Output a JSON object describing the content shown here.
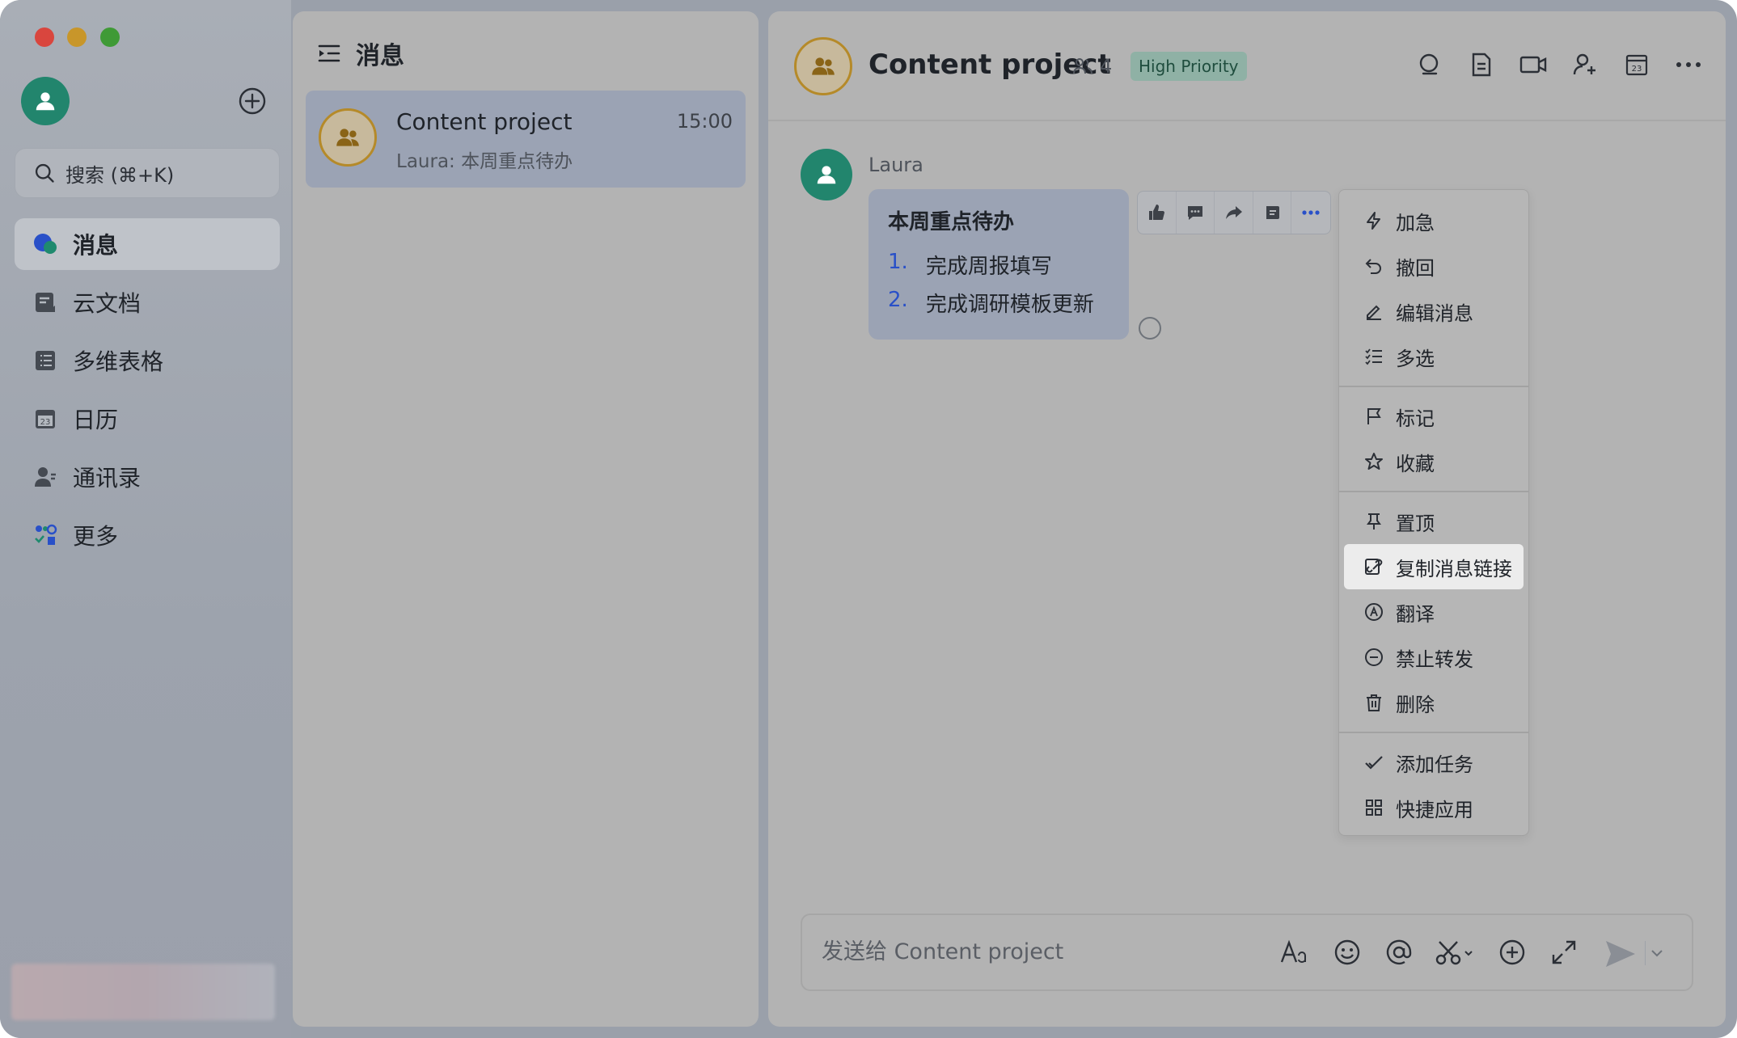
{
  "window": {
    "traffic_lights": [
      "close",
      "minimize",
      "zoom"
    ]
  },
  "sidebar": {
    "search_placeholder": "搜索 (⌘+K)",
    "items": [
      {
        "label": "消息",
        "icon": "chat-bubbles-icon",
        "active": true
      },
      {
        "label": "云文档",
        "icon": "doc-icon"
      },
      {
        "label": "多维表格",
        "icon": "table-icon"
      },
      {
        "label": "日历",
        "icon": "calendar-icon"
      },
      {
        "label": "通讯录",
        "icon": "contacts-icon"
      },
      {
        "label": "更多",
        "icon": "apps-grid-icon"
      }
    ]
  },
  "list": {
    "title": "消息",
    "chats": [
      {
        "name": "Content project",
        "time": "15:00",
        "preview": "Laura: 本周重点待办"
      }
    ]
  },
  "chat": {
    "title": "Content project",
    "members": "4",
    "badge": "High Priority",
    "accent": "#2950c8",
    "message": {
      "sender": "Laura",
      "title": "本周重点待办",
      "items": [
        {
          "num": "1.",
          "text": "完成周报填写"
        },
        {
          "num": "2.",
          "text": "完成调研模板更新"
        }
      ]
    },
    "composer_placeholder": "发送给 Content project"
  },
  "context_menu": {
    "groups": [
      [
        {
          "label": "加急",
          "icon": "lightning-icon"
        },
        {
          "label": "撤回",
          "icon": "undo-icon"
        },
        {
          "label": "编辑消息",
          "icon": "edit-icon"
        },
        {
          "label": "多选",
          "icon": "multi-select-icon"
        }
      ],
      [
        {
          "label": "标记",
          "icon": "flag-icon"
        },
        {
          "label": "收藏",
          "icon": "star-icon"
        }
      ],
      [
        {
          "label": "置顶",
          "icon": "pin-icon"
        },
        {
          "label": "复制消息链接",
          "icon": "link-icon",
          "highlight": true
        },
        {
          "label": "翻译",
          "icon": "translate-icon"
        },
        {
          "label": "禁止转发",
          "icon": "forbid-icon"
        },
        {
          "label": "删除",
          "icon": "trash-icon"
        }
      ],
      [
        {
          "label": "添加任务",
          "icon": "task-check-icon"
        },
        {
          "label": "快捷应用",
          "icon": "quick-apps-icon"
        }
      ]
    ]
  }
}
